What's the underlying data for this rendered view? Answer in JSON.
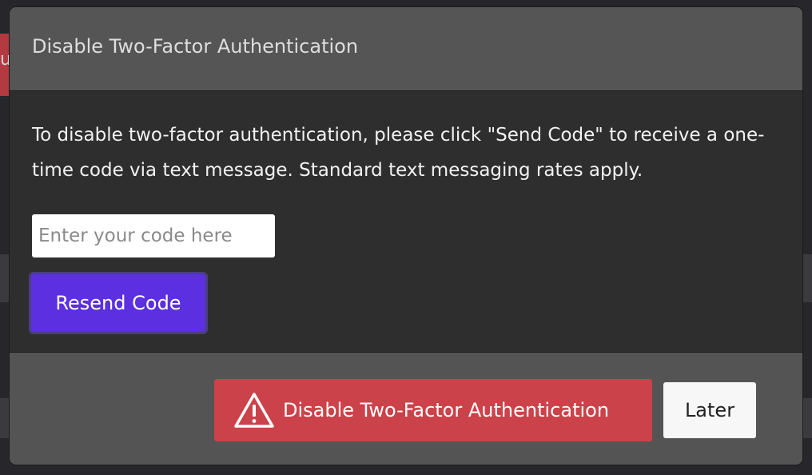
{
  "background": {
    "partial_text": "u"
  },
  "dialog": {
    "title": "Disable Two-Factor Authentication",
    "description": "To disable two-factor authentication, please click \"Send Code\" to receive a one-time code via text message. Standard text messaging rates apply.",
    "code_input": {
      "placeholder": "Enter your code here",
      "value": ""
    },
    "resend_label": "Resend Code",
    "disable_label": "Disable Two-Factor Authentication",
    "disable_icon": "warning-triangle-icon",
    "later_label": "Later"
  },
  "colors": {
    "resend_button": "#5c2fe0",
    "disable_button": "#cc424a",
    "later_button": "#f7f7f7"
  }
}
